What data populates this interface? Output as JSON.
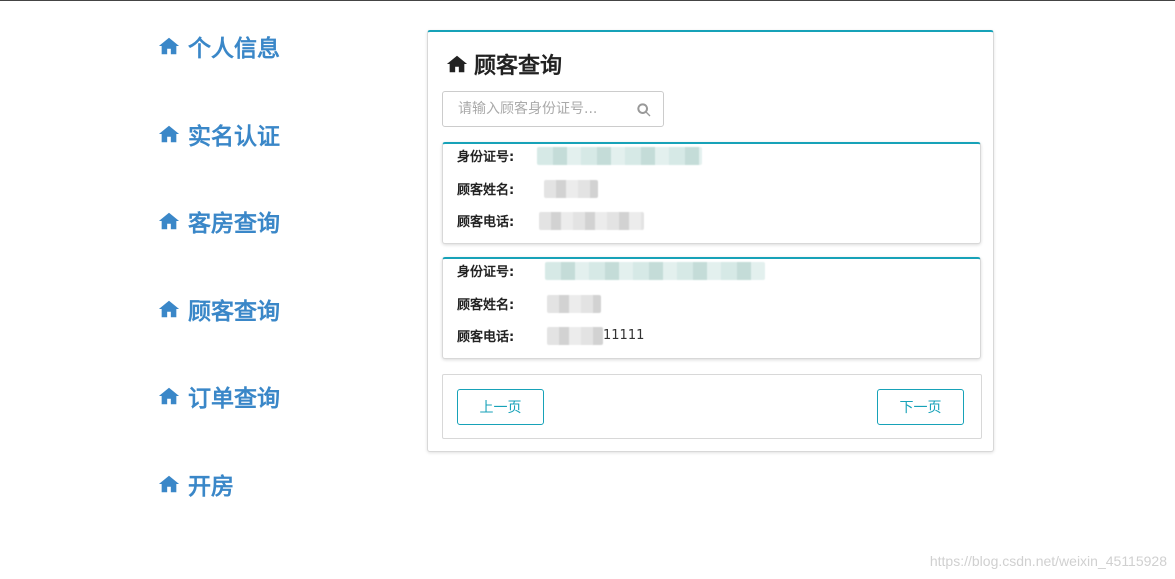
{
  "sidebar": {
    "items": [
      {
        "label": "个人信息",
        "icon": "home-icon"
      },
      {
        "label": "实名认证",
        "icon": "home-icon"
      },
      {
        "label": "客房查询",
        "icon": "home-icon"
      },
      {
        "label": "顾客查询",
        "icon": "home-icon"
      },
      {
        "label": "订单查询",
        "icon": "home-icon"
      },
      {
        "label": "开房",
        "icon": "home-icon"
      }
    ],
    "color": "#3a87c8"
  },
  "main": {
    "title": "顾客查询",
    "title_icon": "home-icon",
    "search": {
      "placeholder": "请输入顾客身份证号...",
      "value": "",
      "icon": "search-icon"
    },
    "records": [
      {
        "id_label": "身份证号:",
        "id_value": "",
        "name_label": "顾客姓名:",
        "name_value": "",
        "phone_label": "顾客电话:",
        "phone_value": ""
      },
      {
        "id_label": "身份证号:",
        "id_value": "",
        "name_label": "顾客姓名:",
        "name_value": "",
        "phone_label": "顾客电话:",
        "phone_value": "11111"
      }
    ],
    "pagination": {
      "prev_label": "上一页",
      "next_label": "下一页"
    },
    "accent_color": "#17a2b8"
  },
  "watermark": "https://blog.csdn.net/weixin_45115928"
}
